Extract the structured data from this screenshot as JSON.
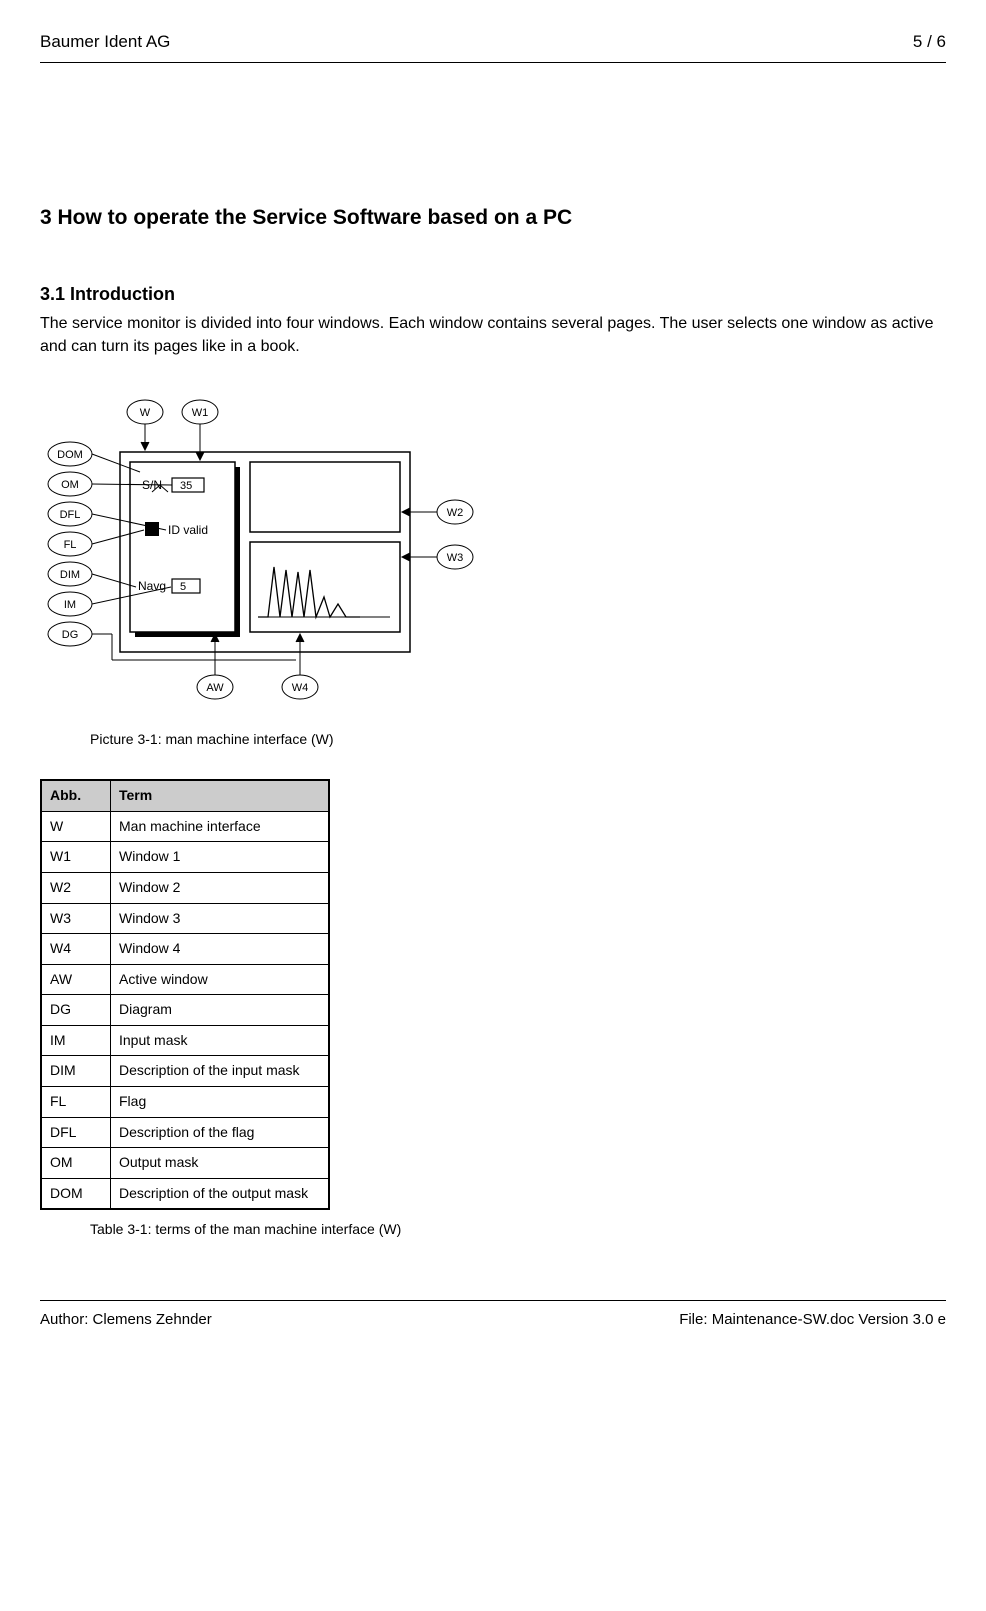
{
  "header": {
    "left": "Baumer Ident AG",
    "right": "5 / 6"
  },
  "section_heading": "3  How to operate the Service Software based on a PC",
  "subsection_heading": "3.1  Introduction",
  "intro_paragraph": "The service monitor is divided into four windows. Each window contains several pages. The user selects one window as active and can turn its pages like in a book.",
  "figure": {
    "labels": {
      "W": "W",
      "W1": "W1",
      "W2": "W2",
      "W3": "W3",
      "W4": "W4",
      "AW": "AW",
      "DOM": "DOM",
      "OM": "OM",
      "DFL": "DFL",
      "FL": "FL",
      "DIM": "DIM",
      "IM": "IM",
      "DG": "DG",
      "SN": "S/N",
      "SN_val": "35",
      "ID_valid": "ID valid",
      "Navg": "Navg",
      "Navg_val": "5"
    },
    "caption": "Picture 3-1: man machine interface (W)"
  },
  "table": {
    "headers": {
      "abb": "Abb.",
      "term": "Term"
    },
    "rows": [
      {
        "abb": "W",
        "term": "Man machine interface"
      },
      {
        "abb": "W1",
        "term": "Window 1"
      },
      {
        "abb": "W2",
        "term": "Window 2"
      },
      {
        "abb": "W3",
        "term": "Window 3"
      },
      {
        "abb": "W4",
        "term": "Window 4"
      },
      {
        "abb": "AW",
        "term": "Active window"
      },
      {
        "abb": "DG",
        "term": "Diagram"
      },
      {
        "abb": "IM",
        "term": "Input mask"
      },
      {
        "abb": "DIM",
        "term": "Description of the input mask"
      },
      {
        "abb": "FL",
        "term": "Flag"
      },
      {
        "abb": "DFL",
        "term": "Description of the flag"
      },
      {
        "abb": "OM",
        "term": "Output mask"
      },
      {
        "abb": "DOM",
        "term": "Description of the output mask"
      }
    ],
    "caption": "Table 3-1: terms of the man machine interface (W)"
  },
  "footer": {
    "left": "Author: Clemens Zehnder",
    "right": "File: Maintenance-SW.doc Version 3.0 e"
  }
}
